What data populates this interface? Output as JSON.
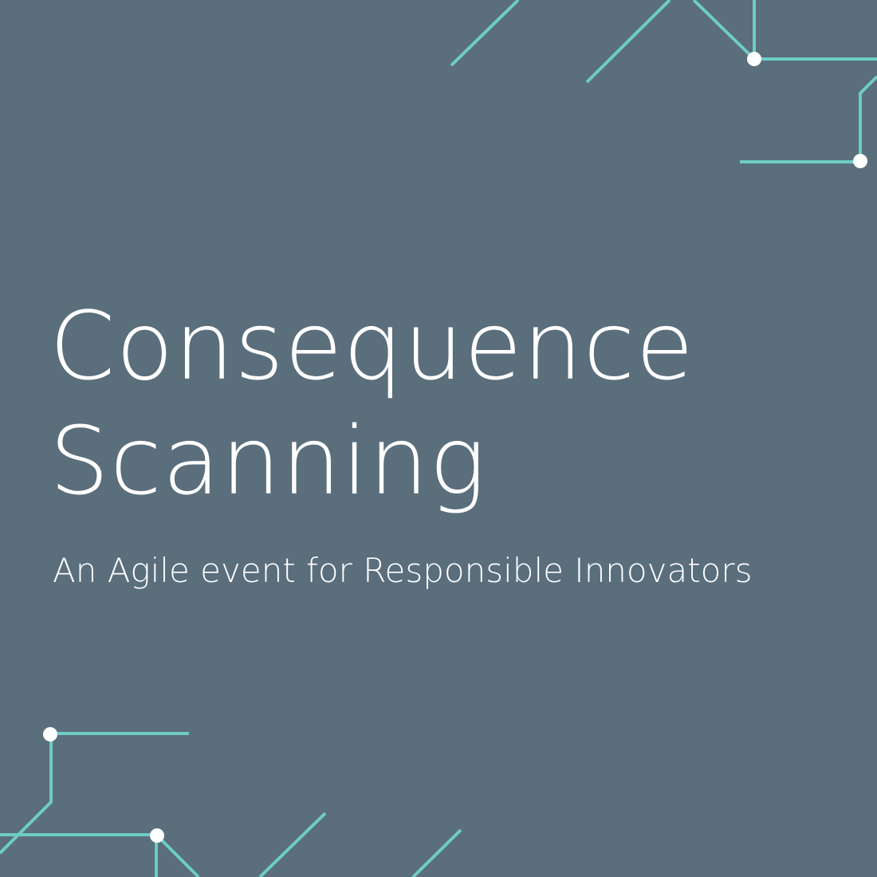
{
  "title": {
    "line1": "Consequence",
    "line2": "Scanning"
  },
  "subtitle": "An Agile event for Responsible Innovators",
  "colors": {
    "background": "#5a6e7c",
    "accent": "#6ecdc3",
    "text": "#ffffff",
    "node": "#ffffff"
  }
}
